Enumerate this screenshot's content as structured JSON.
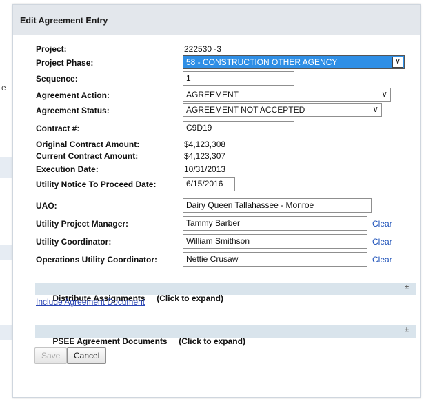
{
  "background": {
    "edge_letter": "e"
  },
  "dialog": {
    "title": "Edit Agreement Entry"
  },
  "form": {
    "project": {
      "label": "Project:",
      "value": "222530 -3"
    },
    "project_phase": {
      "label": "Project Phase:",
      "value": "58 - CONSTRUCTION OTHER AGENCY"
    },
    "sequence": {
      "label": "Sequence:",
      "value": "1"
    },
    "agreement_action": {
      "label": "Agreement Action:",
      "value": "AGREEMENT"
    },
    "agreement_status": {
      "label": "Agreement Status:",
      "value": "AGREEMENT NOT ACCEPTED"
    },
    "contract_no": {
      "label": "Contract #:",
      "value": "C9D19"
    },
    "original_amount": {
      "label": "Original Contract Amount:",
      "value": "$4,123,308"
    },
    "current_amount": {
      "label": "Current Contract Amount:",
      "value": "$4,123,307"
    },
    "execution_date": {
      "label": "Execution Date:",
      "value": "10/31/2013"
    },
    "ntp_date": {
      "label": "Utility Notice To Proceed Date:",
      "value": "6/15/2016"
    },
    "uao": {
      "label": "UAO:",
      "value": "Dairy Queen Tallahassee - Monroe"
    },
    "utility_pm": {
      "label": "Utility Project Manager:",
      "value": "Tammy Barber",
      "clear": "Clear"
    },
    "utility_coord": {
      "label": "Utility Coordinator:",
      "value": "William Smithson",
      "clear": "Clear"
    },
    "ops_coord": {
      "label": "Operations Utility Coordinator:",
      "value": "Nettie Crusaw",
      "clear": "Clear"
    }
  },
  "sections": {
    "distribute": {
      "title": "Distribute Assignments     (Click to expand)",
      "expander": "±"
    },
    "include_doc_link": "Include Agreement Document",
    "psee": {
      "title": "PSEE Agreement Documents     (Click to expand)",
      "expander": "±"
    }
  },
  "buttons": {
    "save": "Save",
    "cancel": "Cancel"
  },
  "colors": {
    "accent_select": "#2f8fe6",
    "section_bar": "#d9e4ec",
    "link": "#1a4fb8",
    "title_bar": "#e3e7ec"
  }
}
